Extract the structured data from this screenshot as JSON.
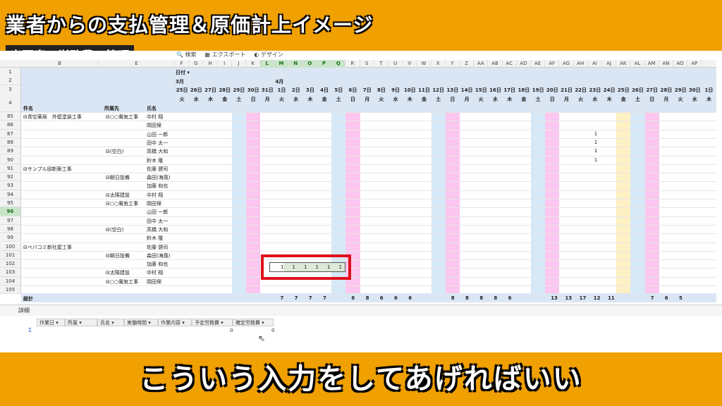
{
  "banner": {
    "title": "業者からの支払管理＆原価計上イメージ",
    "subtitle": "出面表で労務費の管理",
    "caption": "こういう入力をしてあげればいい"
  },
  "toolbar": {
    "items": [
      "検索",
      "エクスポート",
      "デザイン"
    ]
  },
  "grid": {
    "columns": [
      "B",
      "E",
      "F",
      "G",
      "H",
      "I",
      "J",
      "K",
      "L",
      "M",
      "N",
      "O",
      "P",
      "Q",
      "R",
      "S",
      "T",
      "U",
      "V",
      "W",
      "X",
      "Y",
      "Z",
      "AA",
      "AB",
      "AC",
      "AD",
      "AE",
      "AF",
      "AG",
      "AH",
      "AI",
      "AJ",
      "AK",
      "AL",
      "AM",
      "AN",
      "AO",
      "AP"
    ],
    "filter_label": "日付",
    "month_mar": "3月",
    "month_apr": "4月",
    "header_labels": {
      "project": "件名",
      "company": "所属先",
      "person": "氏名"
    },
    "days": [
      "25日",
      "26日",
      "27日",
      "28日",
      "29日",
      "30日",
      "31日",
      "1日",
      "2日",
      "3日",
      "4日",
      "5日",
      "6日",
      "7日",
      "8日",
      "9日",
      "10日",
      "11日",
      "12日",
      "13日",
      "14日",
      "15日",
      "16日",
      "17日",
      "18日",
      "19日",
      "20日",
      "21日",
      "22日",
      "23日",
      "24日",
      "25日",
      "26日",
      "27日",
      "28日",
      "29日",
      "30日",
      "1日"
    ],
    "weekdays": [
      "火",
      "水",
      "木",
      "金",
      "土",
      "日",
      "月",
      "火",
      "水",
      "木",
      "金",
      "土",
      "日",
      "月",
      "火",
      "水",
      "木",
      "金",
      "土",
      "日",
      "月",
      "火",
      "水",
      "木",
      "金",
      "土",
      "日",
      "月",
      "火",
      "水",
      "木",
      "金",
      "土",
      "日",
      "月",
      "火",
      "水",
      "木"
    ],
    "row_numbers": [
      "1",
      "2",
      "3",
      "4",
      "85",
      "86",
      "87",
      "88",
      "89",
      "90",
      "91",
      "92",
      "93",
      "94",
      "95",
      "96",
      "97",
      "98",
      "99",
      "100",
      "101",
      "102",
      "103",
      "104",
      "105"
    ],
    "projects": [
      {
        "row": 0,
        "label": "⊟青空薬局　外壁塗装工事"
      },
      {
        "row": 6,
        "label": "⊟サンプル邸新築工事"
      },
      {
        "row": 15,
        "label": "⊟ベバコミ新社屋工事"
      }
    ],
    "companies": [
      {
        "row": 0,
        "label": "⊟○○電気工事"
      },
      {
        "row": 4,
        "label": "⊟(空白)"
      },
      {
        "row": 7,
        "label": "⊟朝日設備"
      },
      {
        "row": 9,
        "label": "⊟太陽建設"
      },
      {
        "row": 10,
        "label": "⊟○○電気工事"
      },
      {
        "row": 13,
        "label": "⊟(空白)"
      },
      {
        "row": 16,
        "label": "⊟朝日設備"
      },
      {
        "row": 18,
        "label": "⊟太陽建設"
      },
      {
        "row": 19,
        "label": "⊟○○電気工事"
      }
    ],
    "persons": [
      "中村 翔",
      "岡田保",
      "山田 一郎",
      "田中 太一",
      "高橋 大和",
      "鈴木 隆",
      "佐藤 健司",
      "森田(海風)",
      "加藤 和也",
      "中村 翔",
      "岡田保",
      "山田 一郎",
      "田中 太一",
      "高橋 大和",
      "鈴木 隆",
      "佐藤 健司",
      "森田(海風)",
      "加藤 和也",
      "中村 翔",
      "岡田保"
    ],
    "ones_col_ai": [
      "1",
      "1",
      "1",
      "1"
    ],
    "input_values": [
      "1",
      "1",
      "1",
      "1",
      "1",
      "1"
    ],
    "total_label": "総計",
    "totals": [
      {
        "col": 7,
        "v": "7"
      },
      {
        "col": 8,
        "v": "7"
      },
      {
        "col": 9,
        "v": "7"
      },
      {
        "col": 10,
        "v": "7"
      },
      {
        "col": 12,
        "v": "6"
      },
      {
        "col": 13,
        "v": "8"
      },
      {
        "col": 14,
        "v": "6"
      },
      {
        "col": 15,
        "v": "6"
      },
      {
        "col": 16,
        "v": "6"
      },
      {
        "col": 19,
        "v": "8"
      },
      {
        "col": 20,
        "v": "8"
      },
      {
        "col": 21,
        "v": "8"
      },
      {
        "col": 22,
        "v": "8"
      },
      {
        "col": 23,
        "v": "6"
      },
      {
        "col": 26,
        "v": "13"
      },
      {
        "col": 27,
        "v": "13"
      },
      {
        "col": 28,
        "v": "17"
      },
      {
        "col": 29,
        "v": "12"
      },
      {
        "col": 30,
        "v": "11"
      },
      {
        "col": 33,
        "v": "7"
      },
      {
        "col": 34,
        "v": "6"
      },
      {
        "col": 35,
        "v": "5"
      }
    ]
  },
  "detail": {
    "tab_label": "詳細",
    "columns": [
      "作業日",
      "所属",
      "氏名",
      "実働時間",
      "作業内容",
      "予定労務費",
      "確定労務費"
    ],
    "sigma": "Σ",
    "values": [
      "0",
      "0"
    ]
  }
}
